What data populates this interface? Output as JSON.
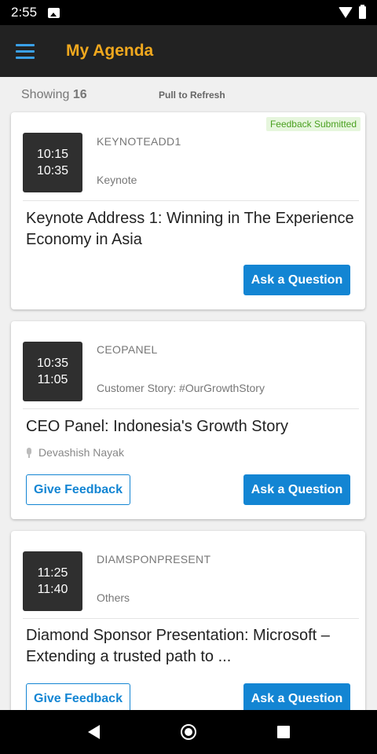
{
  "status_bar": {
    "time": "2:55"
  },
  "app_bar": {
    "title": "My Agenda"
  },
  "list_header": {
    "showing_label": "Showing",
    "count": "16",
    "pull_to_refresh": "Pull to Refresh"
  },
  "sessions": [
    {
      "start": "10:15",
      "end": "10:35",
      "code": "KEYNOTEADD1",
      "track": "Keynote",
      "title": "Keynote Address 1: Winning in The Experience Economy in Asia",
      "badge": "Feedback Submitted",
      "ask_label": "Ask a Question"
    },
    {
      "start": "10:35",
      "end": "11:05",
      "code": "CEOPANEL",
      "track": "Customer Story: #OurGrowthStory",
      "title": "CEO Panel: Indonesia's Growth Story",
      "speaker": "Devashish Nayak",
      "feedback_label": "Give Feedback",
      "ask_label": "Ask a Question"
    },
    {
      "start": "11:25",
      "end": "11:40",
      "code": "DIAMSPONPRESENT",
      "track": "Others",
      "title": "Diamond Sponsor Presentation: Microsoft – Extending a trusted path to ...",
      "feedback_label": "Give Feedback",
      "ask_label": "Ask a Question"
    }
  ],
  "colors": {
    "accent": "#1385d3",
    "title": "#f0a81e",
    "app_bar": "#222222",
    "badge_text": "#4aa020"
  },
  "icons": [
    "photo-icon",
    "wifi-icon",
    "battery-icon",
    "menu-icon",
    "mic-icon",
    "back-icon",
    "home-icon",
    "recents-icon"
  ]
}
